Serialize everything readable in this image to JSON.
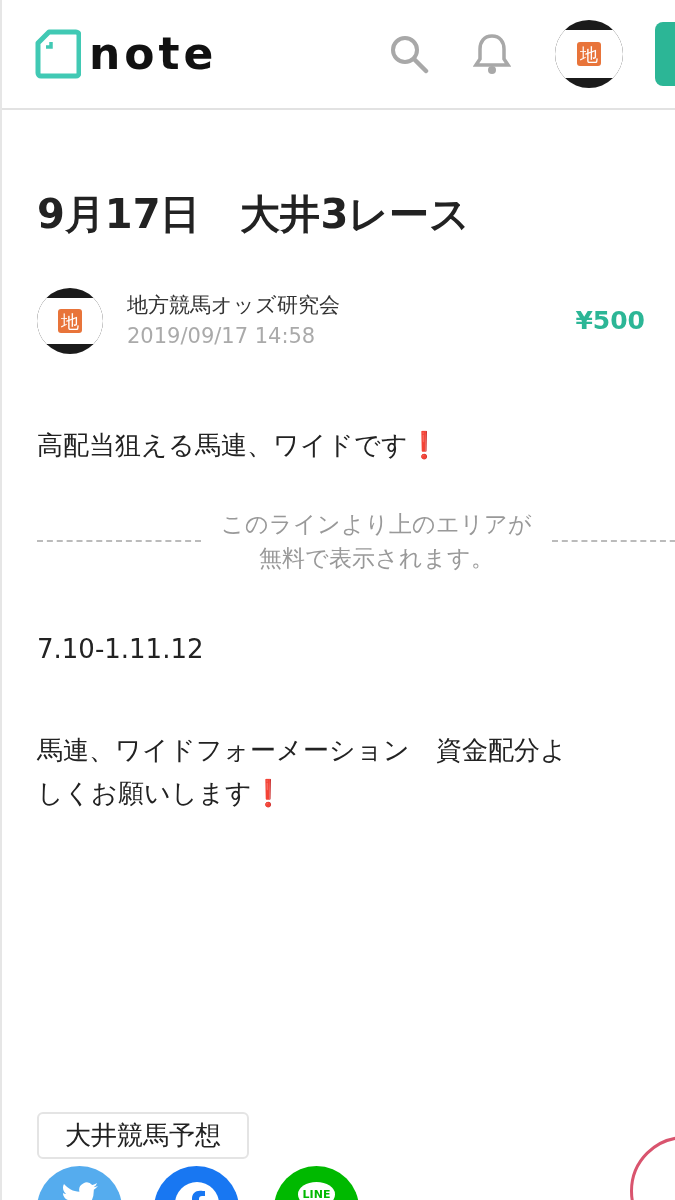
{
  "header": {
    "logo_text": "note",
    "avatar_char": "地"
  },
  "article": {
    "title": "9月17日　大井3レース",
    "author": {
      "name": "地方競馬オッズ研究会",
      "date": "2019/09/17 14:58",
      "avatar_char": "地"
    },
    "price": "¥500",
    "intro": {
      "text": "高配当狙える馬連、ワイドです",
      "mark": "❗"
    },
    "paywall_notice": [
      "このラインより上のエリアが",
      "無料で表示されます。"
    ],
    "paragraphs": [
      {
        "lines": [
          "7.10-1.11.12"
        ]
      },
      {
        "lines": [
          "馬連、ワイドフォーメーション　資金配分よ",
          "しくお願いします"
        ],
        "mark": "❗"
      }
    ],
    "tag": "大井競馬予想"
  },
  "share": [
    {
      "kind": "twitter"
    },
    {
      "kind": "facebook"
    },
    {
      "kind": "line",
      "label": "LINE"
    }
  ]
}
